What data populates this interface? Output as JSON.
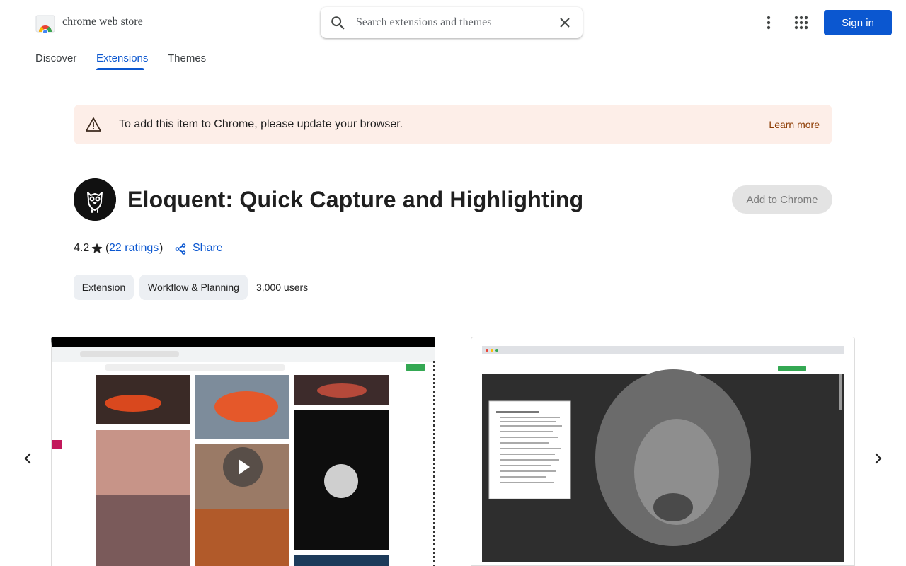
{
  "header": {
    "brand": "chrome web store",
    "search_placeholder": "Search extensions and themes",
    "sign_in": "Sign in"
  },
  "tabs": [
    {
      "label": "Discover",
      "active": false
    },
    {
      "label": "Extensions",
      "active": true
    },
    {
      "label": "Themes",
      "active": false
    }
  ],
  "banner": {
    "message": "To add this item to Chrome, please update your browser.",
    "link": "Learn more"
  },
  "item": {
    "title": "Eloquent: Quick Capture and Highlighting",
    "add_button": "Add to Chrome",
    "rating": "4.2",
    "ratings_count": "22 ratings",
    "share": "Share",
    "type_chip": "Extension",
    "category_chip": "Workflow & Planning",
    "users": "3,000 users"
  },
  "colors": {
    "accent": "#0b57d0",
    "banner_bg": "#fdeee8",
    "learn_more": "#8c3a00",
    "chip_bg": "#eceff3"
  },
  "icons": [
    "chrome-web-store-logo",
    "search-icon",
    "clear-icon",
    "more-vert-icon",
    "apps-grid-icon",
    "warning-icon",
    "owl-app-icon",
    "star-icon",
    "share-icon",
    "chevron-left-icon",
    "chevron-right-icon",
    "play-icon"
  ]
}
